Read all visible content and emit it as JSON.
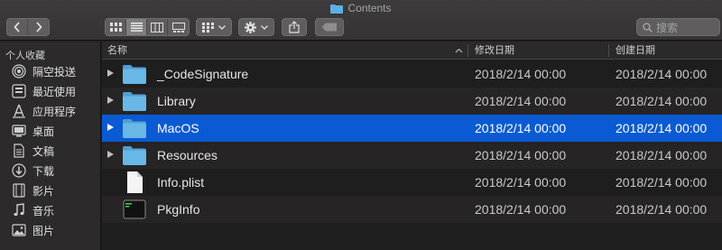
{
  "window": {
    "title": "Contents"
  },
  "toolbar": {
    "back_icon": "chevron-left-icon",
    "forward_icon": "chevron-right-icon",
    "view_modes": [
      "icon-view",
      "list-view",
      "column-view",
      "gallery-view"
    ],
    "active_view": "list-view",
    "search_placeholder": "搜索"
  },
  "sidebar": {
    "header": "个人收藏",
    "items": [
      {
        "label": "隔空投送",
        "icon": "airdrop-icon"
      },
      {
        "label": "最近使用",
        "icon": "recents-icon"
      },
      {
        "label": "应用程序",
        "icon": "applications-icon"
      },
      {
        "label": "桌面",
        "icon": "desktop-icon"
      },
      {
        "label": "文稿",
        "icon": "documents-icon"
      },
      {
        "label": "下载",
        "icon": "downloads-icon"
      },
      {
        "label": "影片",
        "icon": "movies-icon"
      },
      {
        "label": "音乐",
        "icon": "music-icon"
      },
      {
        "label": "图片",
        "icon": "pictures-icon"
      }
    ]
  },
  "list": {
    "columns": {
      "name": "名称",
      "modified": "修改日期",
      "created": "创建日期"
    },
    "rows": [
      {
        "name": "_CodeSignature",
        "modified": "2018/2/14 00:00",
        "created": "2018/2/14 00:00",
        "type": "folder",
        "expandable": true,
        "selected": false
      },
      {
        "name": "Library",
        "modified": "2018/2/14 00:00",
        "created": "2018/2/14 00:00",
        "type": "folder",
        "expandable": true,
        "selected": false
      },
      {
        "name": "MacOS",
        "modified": "2018/2/14 00:00",
        "created": "2018/2/14 00:00",
        "type": "folder",
        "expandable": true,
        "selected": true
      },
      {
        "name": "Resources",
        "modified": "2018/2/14 00:00",
        "created": "2018/2/14 00:00",
        "type": "folder",
        "expandable": true,
        "selected": false
      },
      {
        "name": "Info.plist",
        "modified": "2018/2/14 00:00",
        "created": "2018/2/14 00:00",
        "type": "document",
        "expandable": false,
        "selected": false
      },
      {
        "name": "PkgInfo",
        "modified": "2018/2/14 00:00",
        "created": "2018/2/14 00:00",
        "type": "executable",
        "expandable": false,
        "selected": false
      }
    ]
  },
  "colors": {
    "selection": "#0a5ad4",
    "folder": "#69b7e6",
    "window_bg": "#1e1e1e"
  }
}
